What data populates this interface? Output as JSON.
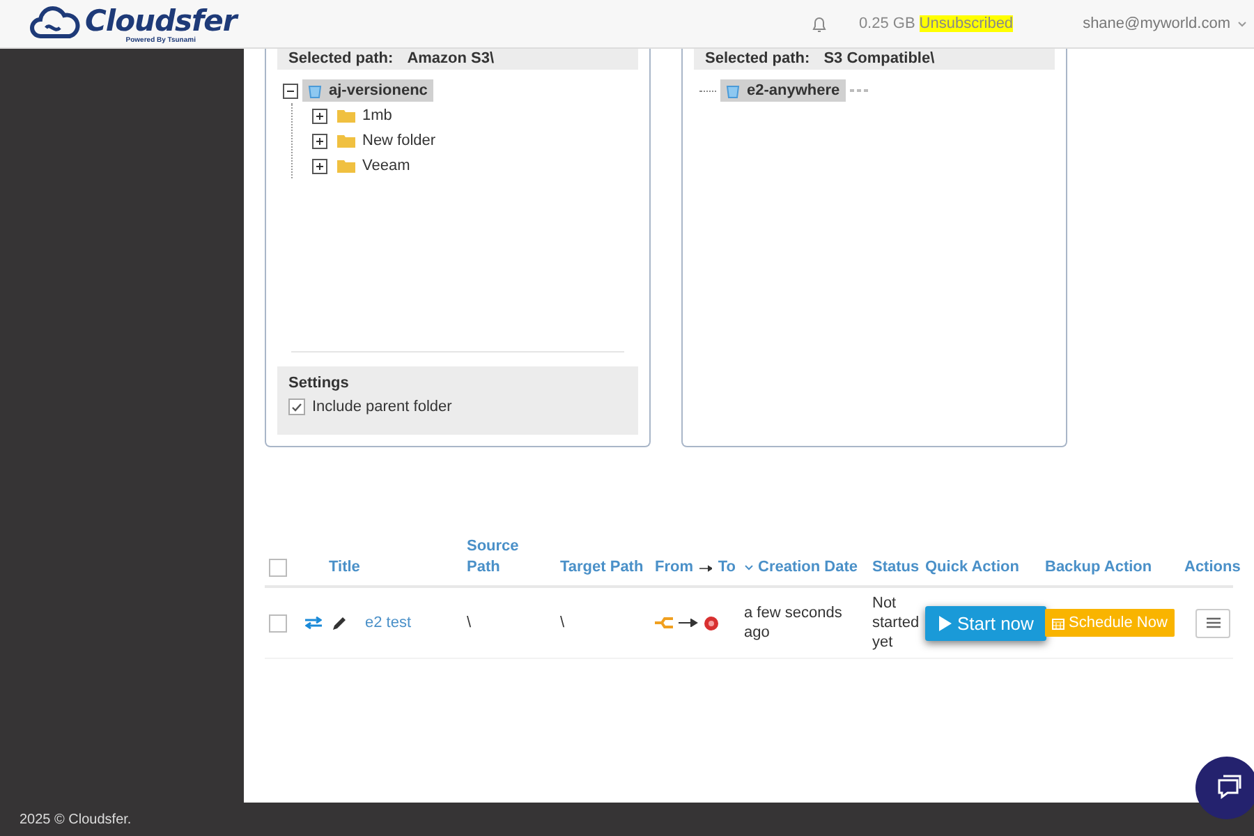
{
  "header": {
    "logo": "Cloudsfer",
    "tagline": "Powered By Tsunami",
    "storage": "0.25 GB",
    "plan": "Unsubscribed",
    "user": "shane@myworld.com"
  },
  "source_panel": {
    "label": "Selected path:",
    "path": "Amazon S3\\",
    "tree": [
      {
        "label": "aj-versionenc",
        "kind": "bucket",
        "expanded": true,
        "selected": true,
        "children": [
          {
            "label": "1mb",
            "kind": "folder",
            "expanded": false,
            "selected": false
          },
          {
            "label": "New folder",
            "kind": "folder",
            "expanded": false,
            "selected": false
          },
          {
            "label": "Veeam",
            "kind": "folder",
            "expanded": false,
            "selected": false
          }
        ]
      }
    ],
    "settings": {
      "title": "Settings",
      "options": [
        {
          "label": "Include parent folder",
          "checked": true
        }
      ]
    }
  },
  "target_panel": {
    "label": "Selected path:",
    "path": "S3 Compatible\\",
    "tree": [
      {
        "label": "e2-anywhere",
        "kind": "bucket",
        "selected": true,
        "loading": true
      }
    ]
  },
  "jobs": {
    "all_checked": false,
    "columns": [
      {
        "label": "Title",
        "kind": "text",
        "sorted": false
      },
      {
        "label": "Source Path",
        "kind": "text",
        "sorted": false
      },
      {
        "label": "Target Path",
        "kind": "text",
        "sorted": false
      },
      {
        "label": "From",
        "label_2": "To",
        "kind": "fromto",
        "sorted": false
      },
      {
        "label": "Creation Date",
        "kind": "text",
        "sorted": true
      },
      {
        "label": "Status",
        "kind": "text",
        "sorted": false
      },
      {
        "label": "Quick Action",
        "kind": "text",
        "sorted": false
      },
      {
        "label": "Backup Action",
        "kind": "text",
        "sorted": false
      },
      {
        "label": "Actions",
        "kind": "text",
        "sorted": false
      }
    ],
    "rows": [
      {
        "checked": false,
        "title": "e2 test",
        "source_path": "\\",
        "target_path": "\\",
        "created": "a few seconds ago",
        "status": "Not started yet",
        "quick_action": "Start now",
        "backup_action": "Schedule Now"
      }
    ]
  },
  "footer": "2025 © Cloudsfer."
}
